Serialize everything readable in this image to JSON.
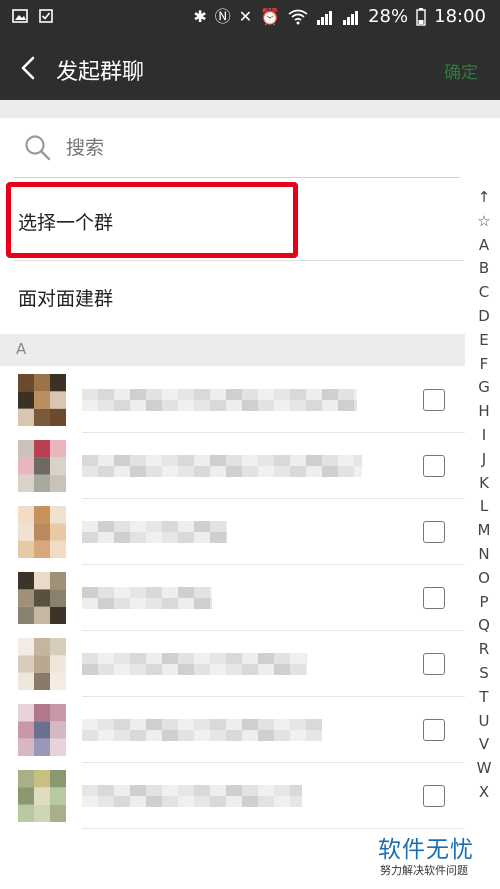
{
  "status_bar": {
    "battery": "28%",
    "time": "18:00"
  },
  "header": {
    "title": "发起群聊",
    "confirm_label": "确定"
  },
  "search": {
    "placeholder": "搜索"
  },
  "options": [
    {
      "label": "选择一个群"
    },
    {
      "label": "面对面建群"
    }
  ],
  "section": {
    "letter": "A"
  },
  "contacts_count_visible": 7,
  "index_letters": [
    "↑",
    "☆",
    "A",
    "B",
    "C",
    "D",
    "E",
    "F",
    "G",
    "H",
    "I",
    "J",
    "K",
    "L",
    "M",
    "N",
    "O",
    "P",
    "Q",
    "R",
    "S",
    "T",
    "U",
    "V",
    "W",
    "X"
  ],
  "watermark": {
    "text": "软件无忧",
    "subtext": "努力解决软件问题"
  },
  "colors": {
    "bar_bg": "#2e2e2e",
    "confirm": "#2f7a3c",
    "highlight_box": "#e6001a",
    "section_bg": "#ececec"
  }
}
